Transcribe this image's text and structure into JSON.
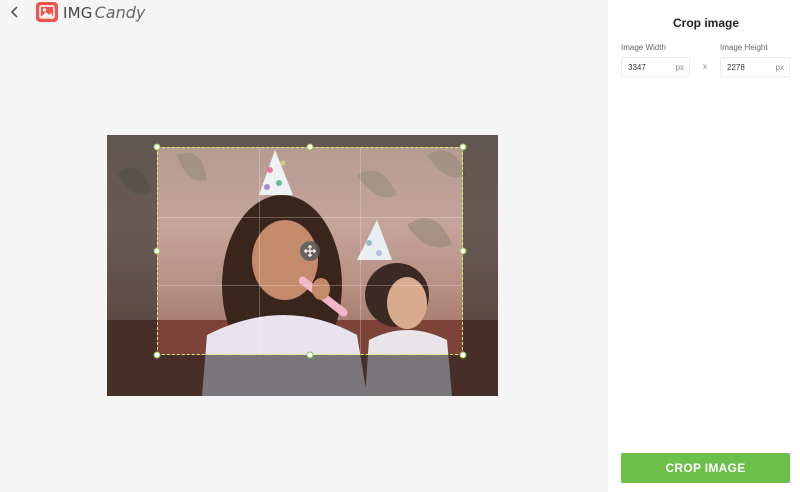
{
  "header": {
    "back_icon": "chevron-left-icon",
    "logo": {
      "icon": "image-icon",
      "text_img": "IMG",
      "text_candy": "Candy",
      "accent": "#f0544f"
    }
  },
  "panel": {
    "title": "Crop image",
    "width_label": "Image Width",
    "height_label": "Image Height",
    "width_value": "3347",
    "height_value": "2278",
    "unit": "px",
    "separator": "x",
    "crop_button": "CROP IMAGE"
  },
  "colors": {
    "button_green": "#6cc04a",
    "crop_border": "#d7f06a",
    "panel_bg": "#ffffff",
    "workspace_bg": "#f5f5f5"
  }
}
